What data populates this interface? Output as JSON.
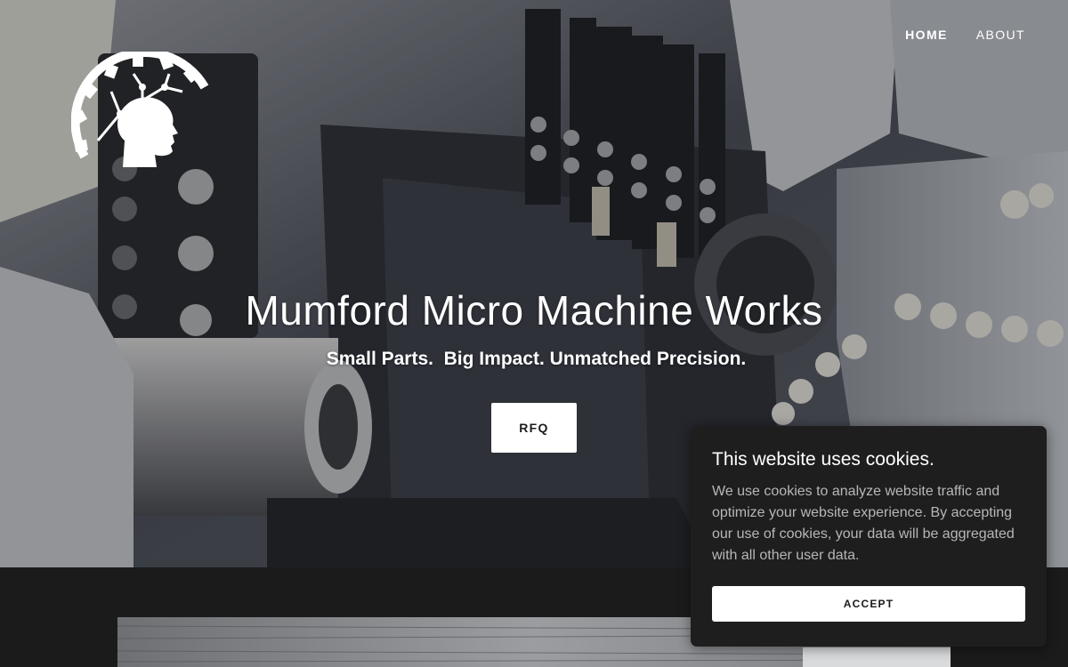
{
  "nav": {
    "items": [
      {
        "label": "HOME",
        "active": true
      },
      {
        "label": "ABOUT",
        "active": false
      }
    ]
  },
  "hero": {
    "title": "Mumford Micro Machine Works",
    "tagline": "Small Parts.  Big Impact. Unmatched Precision.",
    "cta_label": "RFQ",
    "logo_icon": "gear-head-logo"
  },
  "cookie_banner": {
    "title": "This website uses cookies.",
    "body": "We use cookies to analyze website traffic and optimize your website experience. By accepting our use of cookies, your data will be aggregated with all other user data.",
    "accept_label": "ACCEPT"
  },
  "colors": {
    "background_dark": "#1b1b1c",
    "cookie_bg": "#1e1e1f",
    "button_bg": "#ffffff",
    "text_light": "#ffffff",
    "text_muted": "#b7b7b7"
  }
}
